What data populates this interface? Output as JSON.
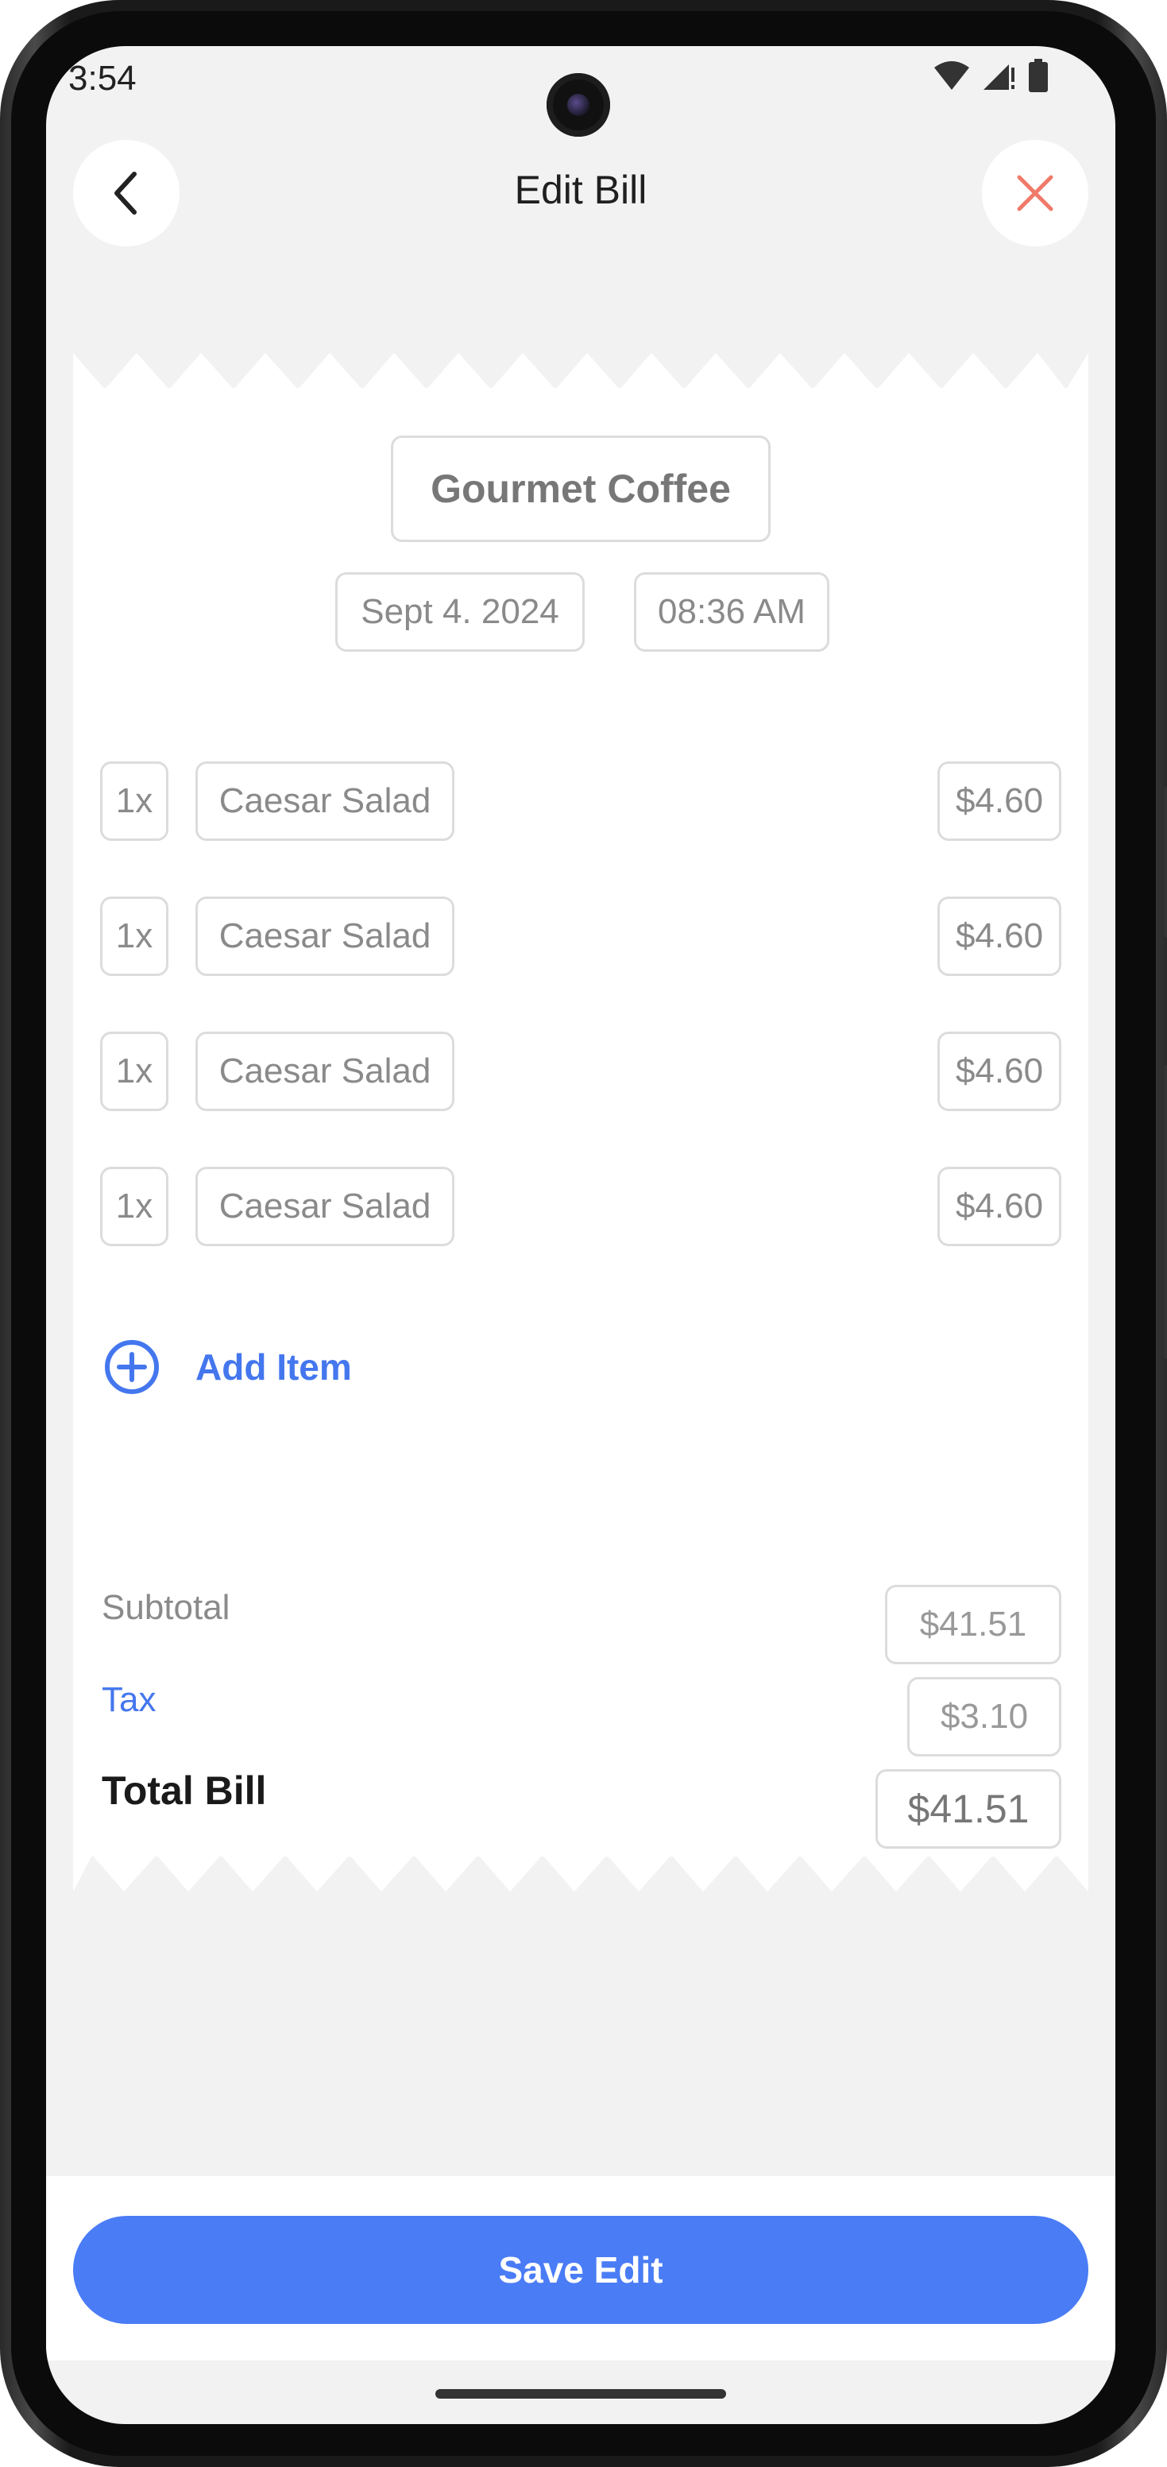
{
  "status_bar": {
    "time": "3:54",
    "icons": [
      "wifi-icon",
      "cell-signal-icon",
      "battery-icon"
    ]
  },
  "header": {
    "title": "Edit Bill",
    "back_icon": "chevron-left-icon",
    "close_icon": "close-icon"
  },
  "receipt": {
    "store_name": "Gourmet Coffee",
    "date": "Sept 4. 2024",
    "time": "08:36 AM",
    "items": [
      {
        "qty": "1x",
        "name": "Caesar Salad",
        "price": "$4.60"
      },
      {
        "qty": "1x",
        "name": "Caesar Salad",
        "price": "$4.60"
      },
      {
        "qty": "1x",
        "name": "Caesar Salad",
        "price": "$4.60"
      },
      {
        "qty": "1x",
        "name": "Caesar Salad",
        "price": "$4.60"
      }
    ],
    "add_item_label": "Add Item",
    "subtotal_label": "Subtotal",
    "subtotal_value": "$41.51",
    "tax_label": "Tax",
    "tax_value": "$3.10",
    "total_label": "Total Bill",
    "total_value": "$41.51"
  },
  "footer": {
    "save_label": "Save Edit"
  },
  "colors": {
    "accent": "#4a7cf6",
    "link": "#4477ee",
    "close": "#f07a6a",
    "background": "#f2f2f2"
  }
}
